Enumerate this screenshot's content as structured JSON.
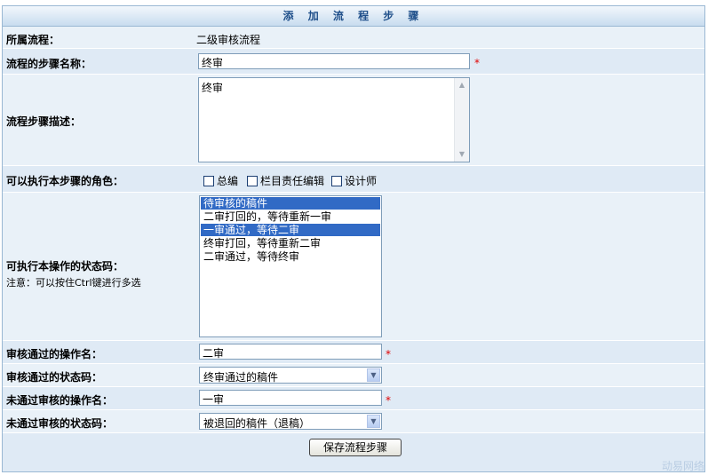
{
  "title": "添 加 流 程 步 骤",
  "form": {
    "flow": {
      "label": "所属流程：",
      "value": "二级审核流程"
    },
    "step_name": {
      "label": "流程的步骤名称：",
      "value": "终审"
    },
    "description": {
      "label": "流程步骤描述：",
      "value": "终审"
    },
    "roles": {
      "label": "可以执行本步骤的角色：",
      "options": [
        "总编",
        "栏目责任编辑",
        "设计师"
      ]
    },
    "status_codes": {
      "label": "可执行本操作的状态码：",
      "note": "注意：可以按住Ctrl键进行多选",
      "options": [
        {
          "text": "待审核的稿件",
          "selected": true
        },
        {
          "text": "二审打回的，等待重新一审",
          "selected": false
        },
        {
          "text": "一审通过，等待二审",
          "selected": true
        },
        {
          "text": "终审打回，等待重新二审",
          "selected": false
        },
        {
          "text": "二审通过，等待终审",
          "selected": false
        }
      ]
    },
    "pass_action": {
      "label": "审核通过的操作名：",
      "value": "二审"
    },
    "pass_status": {
      "label": "审核通过的状态码：",
      "value": "终审通过的稿件"
    },
    "fail_action": {
      "label": "未通过审核的操作名：",
      "value": "一审"
    },
    "fail_status": {
      "label": "未通过审核的状态码：",
      "value": "被退回的稿件（退稿）"
    },
    "required_mark": "*",
    "submit_label": "保存流程步骤"
  },
  "watermark": "动易网络",
  "colors": {
    "selection": "#316ac5",
    "required": "#e00000",
    "title_text": "#1f4f8a"
  }
}
